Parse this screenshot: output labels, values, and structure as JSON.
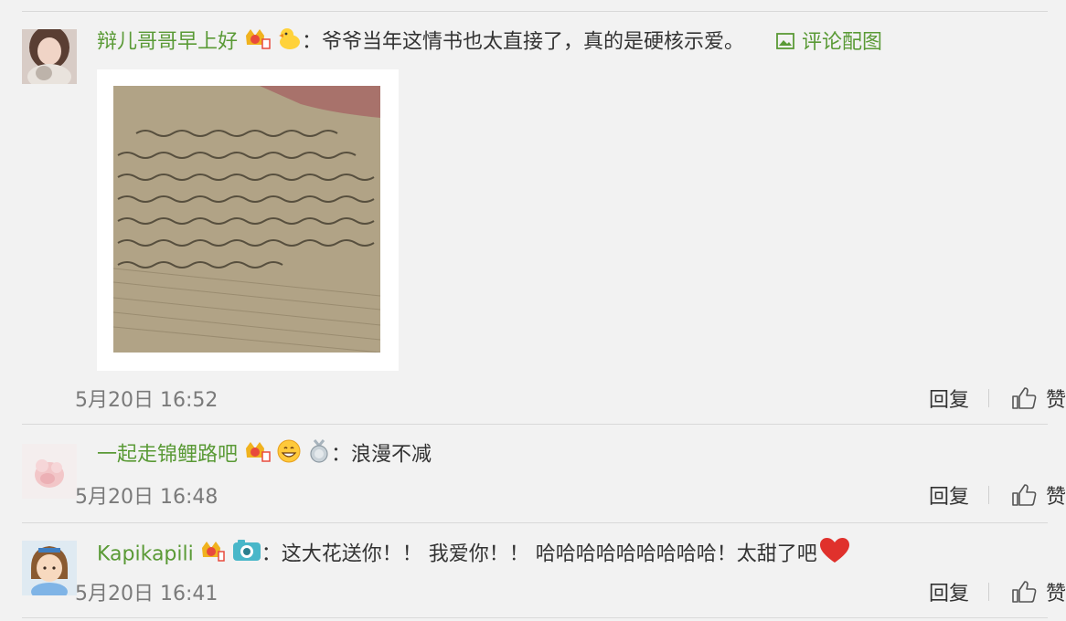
{
  "comments": [
    {
      "username": "辩儿哥哥早上好",
      "colon": "：",
      "text": "爷爷当年这情书也太直接了，真的是硬核示爱。",
      "attachment_label": "评论配图",
      "time": "5月20日 16:52",
      "reply_label": "回复",
      "like_label": "赞",
      "badges": [
        "vip-crown-icon",
        "duck-icon"
      ]
    },
    {
      "username": "一起走锦鲤路吧",
      "colon": "：",
      "text": "浪漫不减",
      "time": "5月20日 16:48",
      "reply_label": "回复",
      "like_label": "赞",
      "badges": [
        "vip-crown-icon",
        "grin-icon",
        "silver-medal-icon"
      ]
    },
    {
      "username": "Kapikapili",
      "colon": "：",
      "text": "这大花送你！！ 我爱你！！ 哈哈哈哈哈哈哈哈哈！太甜了吧",
      "time": "5月20日 16:41",
      "reply_label": "回复",
      "like_label": "赞",
      "badges": [
        "vip-crown-icon",
        "camera-icon"
      ],
      "trailing_emoji": "heart-icon"
    }
  ],
  "colors": {
    "username": "#5a9a36",
    "background": "#f2f2f2",
    "heart": "#e0312c"
  }
}
